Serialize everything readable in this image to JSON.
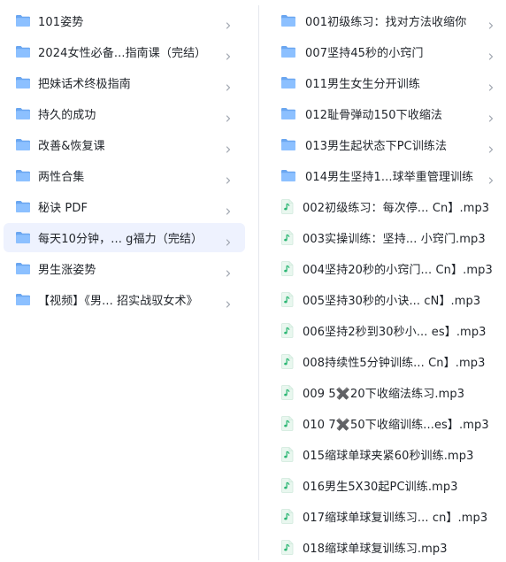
{
  "left_pane": {
    "items": [
      {
        "label": "101姿势",
        "icon": "folder-icon",
        "selected": false
      },
      {
        "label": "2024女性必备...指南课（完结）",
        "icon": "folder-icon",
        "selected": false
      },
      {
        "label": "把妹话术终极指南",
        "icon": "folder-icon",
        "selected": false
      },
      {
        "label": "持久的成功",
        "icon": "folder-icon",
        "selected": false
      },
      {
        "label": "改善&恢复课",
        "icon": "folder-icon",
        "selected": false
      },
      {
        "label": "两性合集",
        "icon": "folder-icon",
        "selected": false
      },
      {
        "label": "秘诀 PDF",
        "icon": "folder-icon",
        "selected": false
      },
      {
        "label": "每天10分钟，... g福力（完结）",
        "icon": "folder-icon",
        "selected": true
      },
      {
        "label": "男生涨姿势",
        "icon": "folder-icon",
        "selected": false
      },
      {
        "label": "【视频】《男... 招实战驭女术》",
        "icon": "folder-icon",
        "selected": false
      }
    ]
  },
  "right_pane": {
    "items": [
      {
        "label": "001初级练习：找对方法收缩你",
        "icon": "folder-icon",
        "has_chevron": true
      },
      {
        "label": "007坚持45秒的小窍门",
        "icon": "folder-icon",
        "has_chevron": true
      },
      {
        "label": "011男生女生分开训练",
        "icon": "folder-icon",
        "has_chevron": true
      },
      {
        "label": "012耻骨弹动150下收缩法",
        "icon": "folder-icon",
        "has_chevron": true
      },
      {
        "label": "013男生起状态下PC训练法",
        "icon": "folder-icon",
        "has_chevron": true
      },
      {
        "label": "014男生坚持1...球举重管理训练",
        "icon": "folder-icon",
        "has_chevron": true
      },
      {
        "label": "002初级练习：每次停... Cn】.mp3",
        "icon": "audio-file-icon",
        "has_chevron": false
      },
      {
        "label": "003实操训练：坚持... 小窍门.mp3",
        "icon": "audio-file-icon",
        "has_chevron": false
      },
      {
        "label": "004坚持20秒的小窍门... Cn】.mp3",
        "icon": "audio-file-icon",
        "has_chevron": false
      },
      {
        "label": "005坚持30秒的小诀...   cN】.mp3",
        "icon": "audio-file-icon",
        "has_chevron": false
      },
      {
        "label": "006坚持2秒到30秒小...  es】.mp3",
        "icon": "audio-file-icon",
        "has_chevron": false
      },
      {
        "label": "008持续性5分钟训练... Cn】.mp3",
        "icon": "audio-file-icon",
        "has_chevron": false
      },
      {
        "label": "009 5✖️20下收缩法练习.mp3",
        "icon": "audio-file-icon",
        "has_chevron": false
      },
      {
        "label": "010 7✖️50下收缩训练...es】.mp3",
        "icon": "audio-file-icon",
        "has_chevron": false
      },
      {
        "label": "015缩球单球夹紧60秒训练.mp3",
        "icon": "audio-file-icon",
        "has_chevron": false
      },
      {
        "label": "016男生5X30起PC训练.mp3",
        "icon": "audio-file-icon",
        "has_chevron": false
      },
      {
        "label": "017缩球单球复训练习... cn】.mp3",
        "icon": "audio-file-icon",
        "has_chevron": false
      },
      {
        "label": "018缩球单球复训练习.mp3",
        "icon": "audio-file-icon",
        "has_chevron": false
      }
    ]
  },
  "colors": {
    "folder_back": "#6aa6f0",
    "folder_front": "#8cc0ff",
    "audio_green": "#2bb673",
    "audio_bg": "#e9f7ef",
    "selected_bg": "#eef2fe",
    "chevron": "#9aa0ab",
    "text": "#1f2329"
  }
}
